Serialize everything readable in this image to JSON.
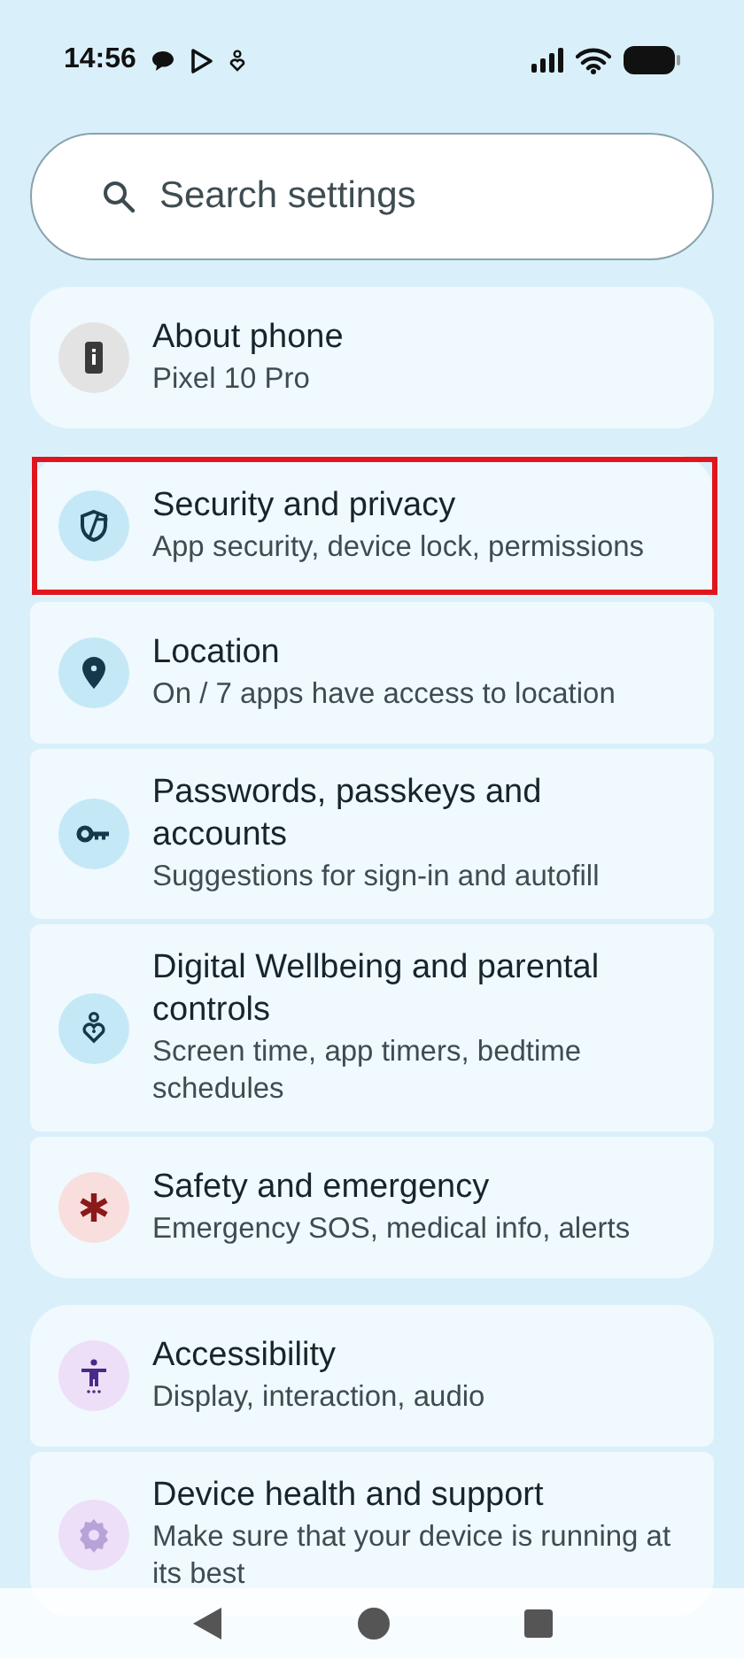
{
  "status_bar": {
    "time": "14:56"
  },
  "search": {
    "placeholder": "Search settings"
  },
  "groups": [
    {
      "items": [
        {
          "title": "About phone",
          "subtitle": "Pixel 10 Pro",
          "kind": "phone-info",
          "color": "#e3e3e3",
          "highlighted": false
        }
      ]
    },
    {
      "items": [
        {
          "title": "Security and privacy",
          "subtitle": "App security, device lock, permissions",
          "kind": "shield",
          "color": "#c5e8f7",
          "highlighted": true
        },
        {
          "title": "Location",
          "subtitle": "On / 7 apps have access to location",
          "kind": "pin",
          "color": "#c5e8f7",
          "highlighted": false
        },
        {
          "title": "Passwords, passkeys and accounts",
          "subtitle": "Suggestions for sign-in and autofill",
          "kind": "key",
          "color": "#c5e8f7",
          "highlighted": false
        },
        {
          "title": "Digital Wellbeing and parental controls",
          "subtitle": "Screen time, app timers, bedtime schedules",
          "kind": "wellbeing",
          "color": "#c5e8f7",
          "highlighted": false
        },
        {
          "title": "Safety and emergency",
          "subtitle": "Emergency SOS, medical info, alerts",
          "kind": "asterisk",
          "color": "#f9dede",
          "highlighted": false
        }
      ]
    },
    {
      "items": [
        {
          "title": "Accessibility",
          "subtitle": "Display, interaction, audio",
          "kind": "accessibility",
          "color": "#ecdff7",
          "highlighted": false
        },
        {
          "title": "Device health and support",
          "subtitle": "Make sure that your device is running at its best",
          "kind": "gear",
          "color": "#ecdff7",
          "highlighted": false
        }
      ]
    }
  ]
}
